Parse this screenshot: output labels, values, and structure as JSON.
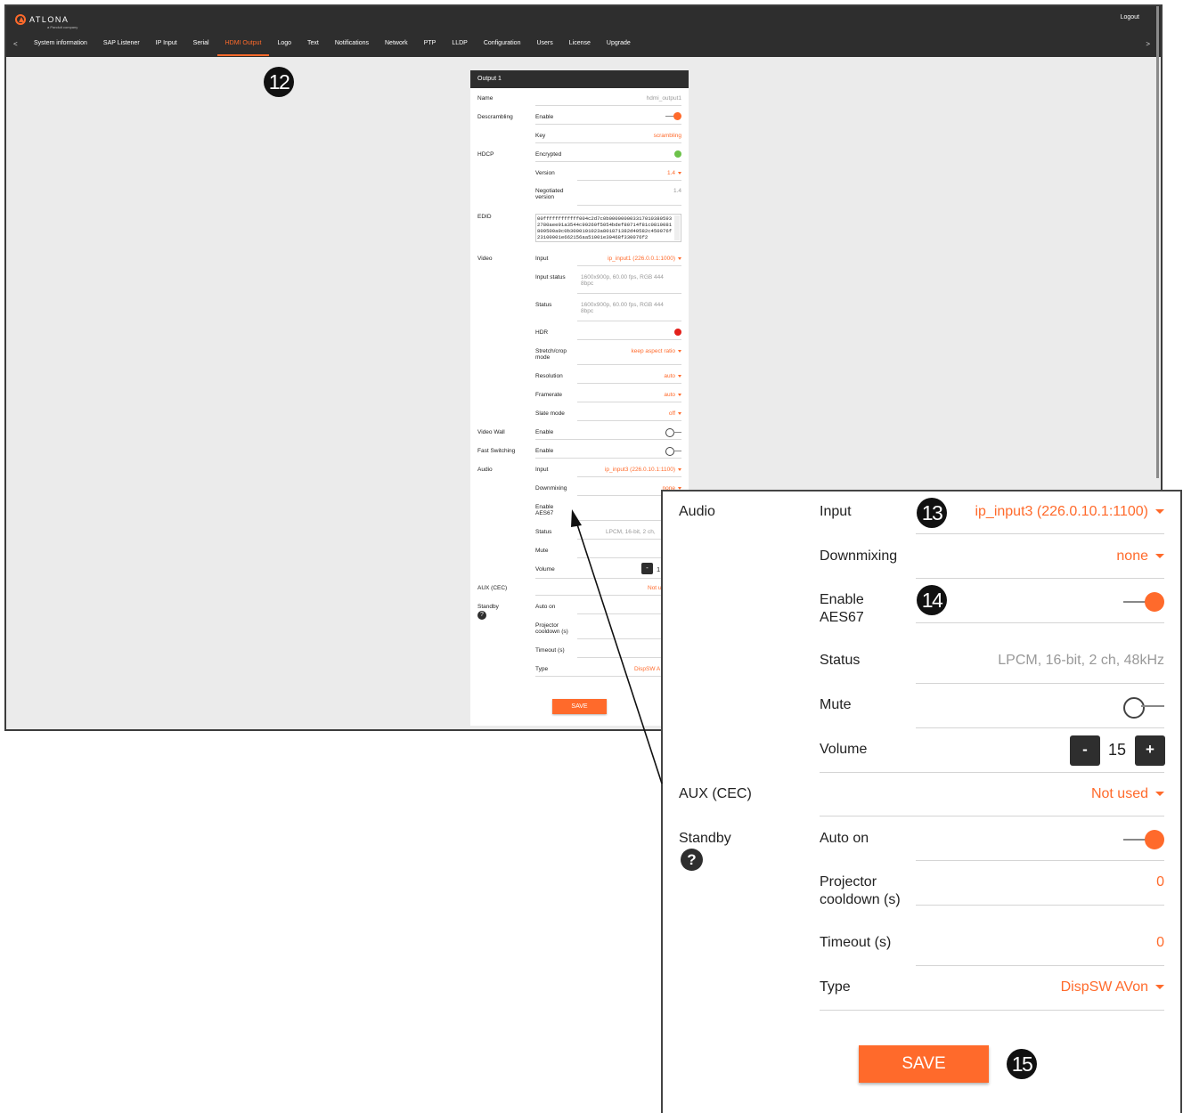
{
  "header": {
    "brand": "ATLONA",
    "brand_sub": "a Panduit company",
    "logout": "Logout",
    "nav_prev": "<",
    "nav_next": ">",
    "tabs": [
      {
        "label": "System information"
      },
      {
        "label": "SAP Listener"
      },
      {
        "label": "IP Input"
      },
      {
        "label": "Serial"
      },
      {
        "label": "HDMI Output",
        "active": true
      },
      {
        "label": "Logo"
      },
      {
        "label": "Text"
      },
      {
        "label": "Notifications"
      },
      {
        "label": "Network"
      },
      {
        "label": "PTP"
      },
      {
        "label": "LLDP"
      },
      {
        "label": "Configuration"
      },
      {
        "label": "Users"
      },
      {
        "label": "License"
      },
      {
        "label": "Upgrade"
      }
    ]
  },
  "callouts": {
    "c12": "12",
    "c13": "13",
    "c14": "14",
    "c15": "15"
  },
  "panel": {
    "title": "Output 1",
    "name_label": "Name",
    "name_value": "hdmi_output1",
    "descrambling_label": "Descrambling",
    "enable_label": "Enable",
    "key_label": "Key",
    "key_value": "scrambling",
    "hdcp_label": "HDCP",
    "encrypted_label": "Encrypted",
    "version_label": "Version",
    "version_value": "1.4",
    "negotiated_label": "Negotiated version",
    "negotiated_value": "1.4",
    "edid_label": "EDID",
    "edid_value": "00ffffffffffff004c2d7c0b0000000033170103805932780aee91a3544c99260f5054bdef80714f81c0810081809500a9c0b3000101023a801871382d40582c450076f23100001e662156aa51001e30468f330076f2",
    "video_label": "Video",
    "input_label": "Input",
    "video_input_value": "ip_input1 (226.0.0.1:1000)",
    "input_status_label": "Input status",
    "input_status_value": "1600x900p, 60.00 fps, RGB 444 8bpc",
    "status_label": "Status",
    "status_value": "1600x900p, 60.00 fps, RGB 444 8bpc",
    "hdr_label": "HDR",
    "stretch_label": "Stretch/crop mode",
    "stretch_value": "keep aspect ratio",
    "resolution_label": "Resolution",
    "resolution_value": "auto",
    "framerate_label": "Framerate",
    "framerate_value": "auto",
    "slate_label": "Slate mode",
    "slate_value": "off",
    "videowall_label": "Video Wall",
    "fastswitch_label": "Fast Switching",
    "audio_label": "Audio",
    "audio_input_value": "ip_input3 (226.0.10.1:1100)",
    "downmix_label": "Downmixing",
    "downmix_value": "none",
    "aes67_label": "Enable AES67",
    "audio_status_value": "LPCM, 16-bit, 2 ch,",
    "mute_label": "Mute",
    "volume_label": "Volume",
    "volume_value": "1",
    "aux_label": "AUX (CEC)",
    "aux_value": "Not u",
    "standby_label": "Standby",
    "autoon_label": "Auto on",
    "projector_label": "Projector cooldown (s)",
    "timeout_label": "Timeout (s)",
    "type_label": "Type",
    "type_value": "DispSW A",
    "save": "SAVE"
  },
  "zoom": {
    "audio_label": "Audio",
    "input_label": "Input",
    "input_value": "ip_input3 (226.0.10.1:1100)",
    "downmix_label": "Downmixing",
    "downmix_value": "none",
    "aes67_label": "Enable AES67",
    "status_label": "Status",
    "status_value": "LPCM, 16-bit, 2 ch, 48kHz",
    "mute_label": "Mute",
    "volume_label": "Volume",
    "volume_value": "15",
    "minus": "-",
    "plus": "+",
    "aux_label": "AUX (CEC)",
    "aux_value": "Not used",
    "standby_label": "Standby",
    "help": "?",
    "autoon_label": "Auto on",
    "projector_label": "Projector cooldown (s)",
    "projector_value": "0",
    "timeout_label": "Timeout (s)",
    "timeout_value": "0",
    "type_label": "Type",
    "type_value": "DispSW AVon",
    "save": "SAVE"
  },
  "colors": {
    "accent": "#ff6a2b",
    "dark": "#2e2e2e",
    "green": "#6cc24a",
    "red": "#e3201b"
  }
}
